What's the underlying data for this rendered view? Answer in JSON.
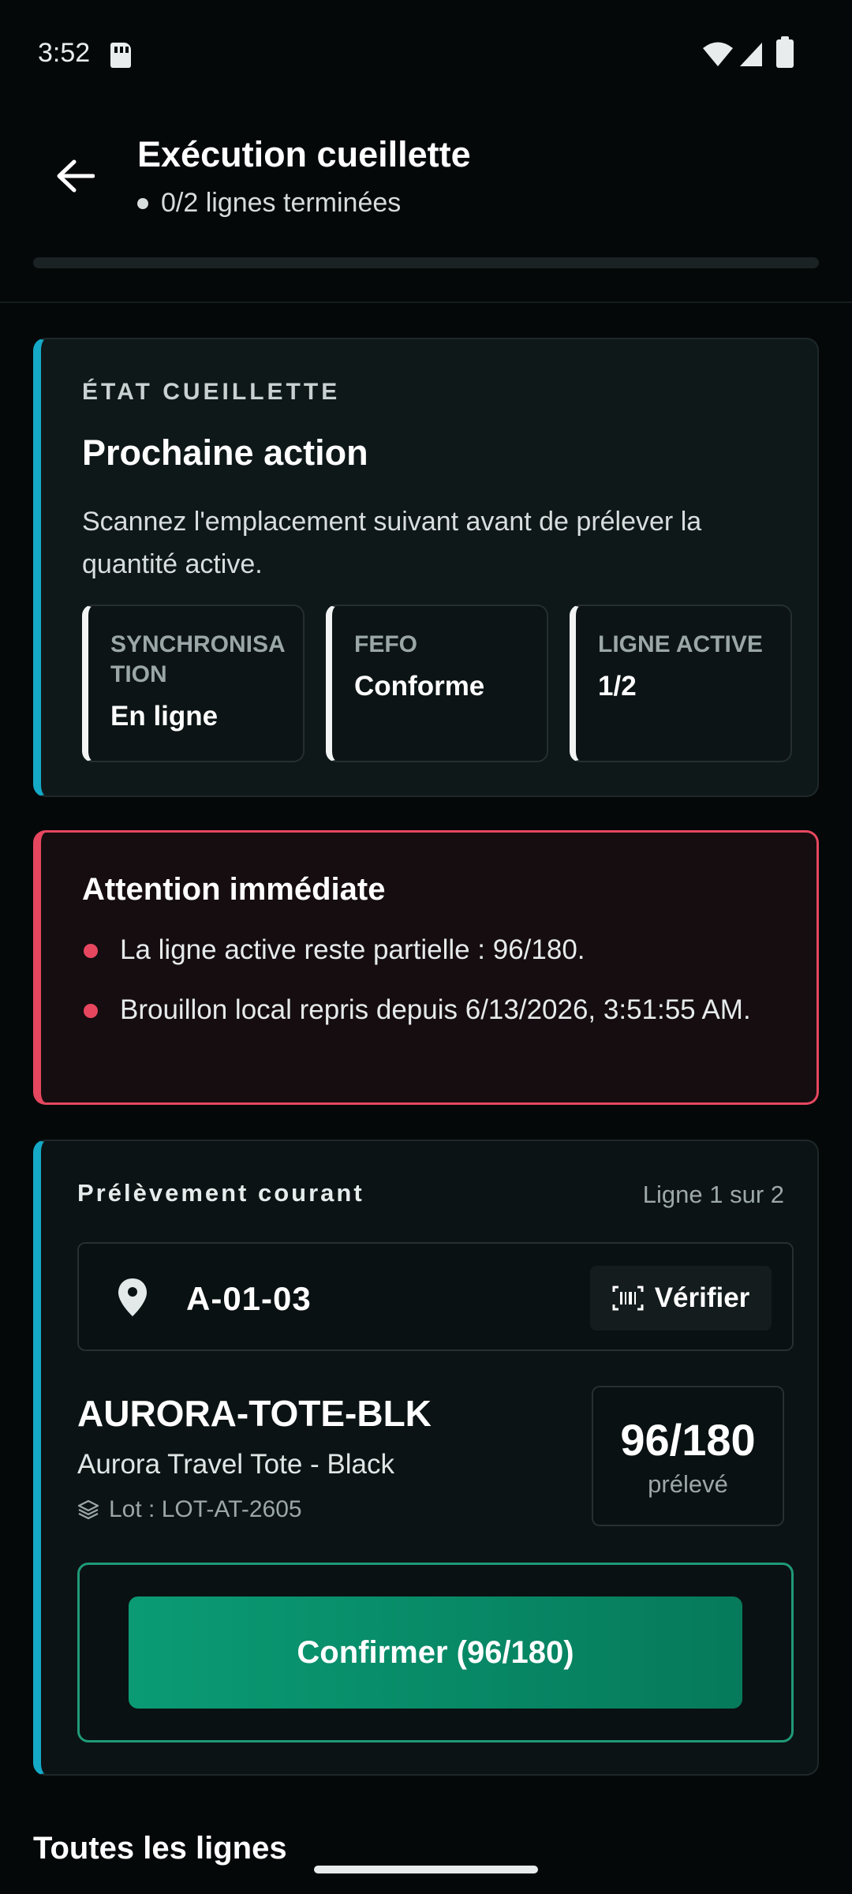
{
  "status_bar": {
    "time": "3:52"
  },
  "header": {
    "title": "Exécution cueillette",
    "subtitle": "0/2 lignes terminées",
    "progress_fraction": 0
  },
  "state_card": {
    "eyebrow": "ÉTAT CUEILLETTE",
    "title": "Prochaine action",
    "description": "Scannez l'emplacement suivant avant de prélever la quantité active.",
    "chips": [
      {
        "label": "SYNCHRONISATION",
        "value": "En ligne"
      },
      {
        "label": "FEFO",
        "value": "Conforme"
      },
      {
        "label": "LIGNE ACTIVE",
        "value": "1/2"
      }
    ]
  },
  "alert_card": {
    "title": "Attention immédiate",
    "items": [
      "La ligne active reste partielle : 96/180.",
      "Brouillon local repris depuis 6/13/2026, 3:51:55 AM."
    ]
  },
  "pick_card": {
    "title": "Prélèvement courant",
    "line_count": "Ligne 1 sur 2",
    "location": "A-01-03",
    "verify_label": "Vérifier",
    "sku": "AURORA-TOTE-BLK",
    "product_name": "Aurora Travel Tote - Black",
    "lot": "Lot : LOT-AT-2605",
    "qty_value": "96/180",
    "qty_label": "prélevé",
    "confirm_label": "Confirmer (96/180)"
  },
  "lines_section": {
    "title": "Toutes les lignes"
  },
  "colors": {
    "accent": "#14a9c6",
    "alert": "#e6475f",
    "confirm": "#0a9b74",
    "background": "#050809"
  }
}
